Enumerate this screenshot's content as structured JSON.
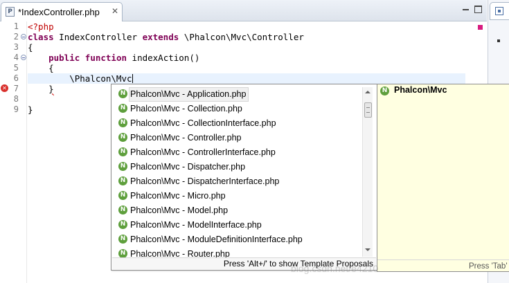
{
  "tab": {
    "icon_letter": "P",
    "title": "*IndexController.php",
    "close": "✕"
  },
  "right_panel": {
    "icon": "outline-icon"
  },
  "editor": {
    "line_numbers": [
      "1",
      "2",
      "3",
      "4",
      "5",
      "6",
      "7",
      "8",
      "9"
    ],
    "lines": [
      {
        "parts": [
          {
            "cls": "tag",
            "t": "<?php"
          }
        ]
      },
      {
        "parts": [
          {
            "cls": "kw",
            "t": "class"
          },
          {
            "cls": "",
            "t": " IndexController "
          },
          {
            "cls": "kw",
            "t": "extends"
          },
          {
            "cls": "",
            "t": " \\Phalcon\\Mvc\\Controller"
          }
        ]
      },
      {
        "parts": [
          {
            "cls": "",
            "t": "{"
          }
        ]
      },
      {
        "parts": [
          {
            "cls": "",
            "t": "    "
          },
          {
            "cls": "kw",
            "t": "public"
          },
          {
            "cls": "",
            "t": " "
          },
          {
            "cls": "kw",
            "t": "function"
          },
          {
            "cls": "",
            "t": " indexAction()"
          }
        ]
      },
      {
        "parts": [
          {
            "cls": "",
            "t": "    {"
          }
        ]
      },
      {
        "parts": [
          {
            "cls": "",
            "t": "        \\Phalcon\\Mvc"
          }
        ],
        "cursor": true
      },
      {
        "parts": [
          {
            "cls": "",
            "t": "    "
          },
          {
            "cls": "brace-err",
            "t": "}"
          }
        ]
      },
      {
        "parts": [
          {
            "cls": "",
            "t": ""
          }
        ]
      },
      {
        "parts": [
          {
            "cls": "",
            "t": "}"
          }
        ]
      }
    ],
    "error_icon": "error-icon"
  },
  "assist": {
    "items": [
      "Phalcon\\Mvc - Application.php",
      "Phalcon\\Mvc - Collection.php",
      "Phalcon\\Mvc - CollectionInterface.php",
      "Phalcon\\Mvc - Controller.php",
      "Phalcon\\Mvc - ControllerInterface.php",
      "Phalcon\\Mvc - Dispatcher.php",
      "Phalcon\\Mvc - DispatcherInterface.php",
      "Phalcon\\Mvc - Micro.php",
      "Phalcon\\Mvc - Model.php",
      "Phalcon\\Mvc - ModelInterface.php",
      "Phalcon\\Mvc - ModuleDefinitionInterface.php",
      "Phalcon\\Mvc - Router.php"
    ],
    "selected_index": 0,
    "item_icon_letter": "N",
    "hint": "Press 'Alt+/' to show Template Proposals"
  },
  "info": {
    "icon_letter": "N",
    "title": "Phalcon\\Mvc",
    "hint": "Press 'Tab'"
  },
  "watermark": "blog.csdn.net/e4210"
}
